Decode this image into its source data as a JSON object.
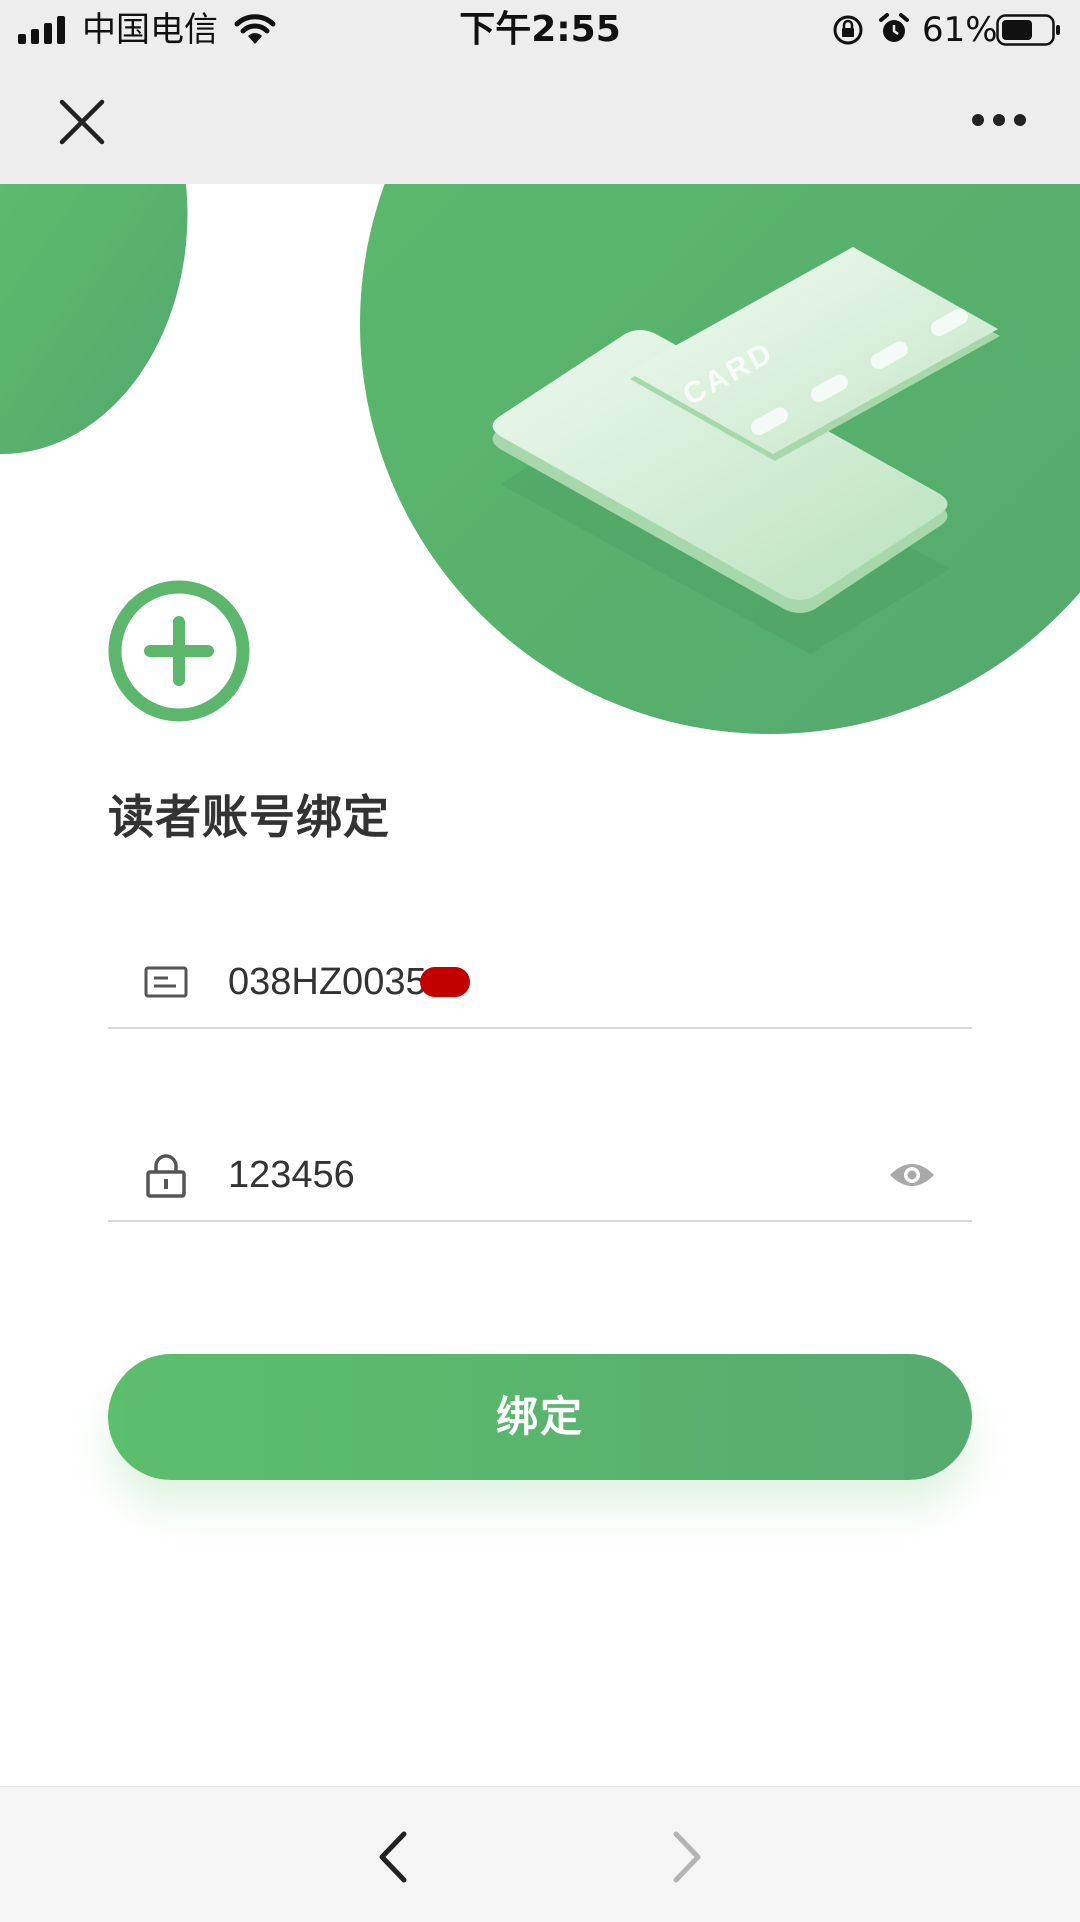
{
  "status_bar": {
    "carrier": "中国电信",
    "time": "下午2:55",
    "battery": "61%"
  },
  "nav": {
    "close_icon": "close-icon",
    "more_icon": "more-icon"
  },
  "hero": {
    "card_text": "CARD"
  },
  "page_title": "读者账号绑定",
  "form": {
    "account_value": "038HZ0035",
    "password_value": "123456"
  },
  "bind_button_label": "绑定",
  "colors": {
    "brand_green": "#5cb76c",
    "button_gradient_start": "#5cbf6c",
    "button_gradient_end": "#56ab6f",
    "redaction": "#c20000"
  }
}
